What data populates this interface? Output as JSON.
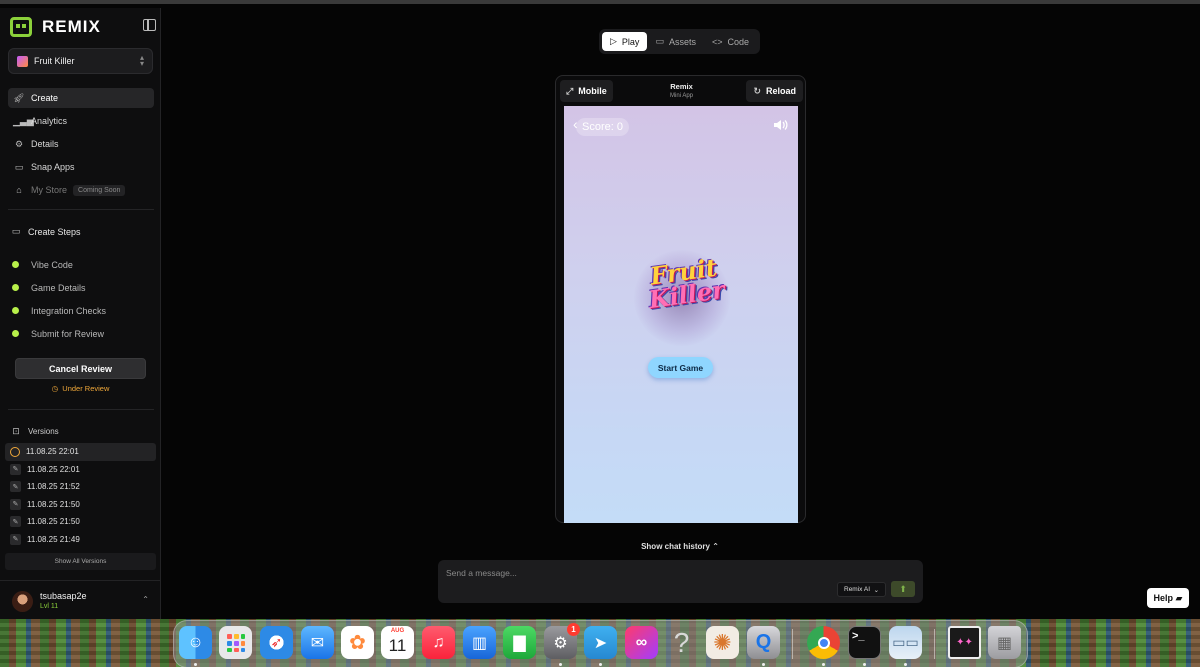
{
  "brand": {
    "name": "REMIX"
  },
  "project": {
    "name": "Fruit Killer"
  },
  "nav": [
    {
      "label": "Create",
      "icon": "rocket-icon"
    },
    {
      "label": "Analytics",
      "icon": "bar-chart-icon"
    },
    {
      "label": "Details",
      "icon": "gear-icon"
    },
    {
      "label": "Snap Apps",
      "icon": "monitor-icon"
    },
    {
      "label": "My Store",
      "icon": "store-icon",
      "badge": "Coming Soon"
    }
  ],
  "create_steps": {
    "title": "Create Steps",
    "items": [
      "Vibe Code",
      "Game Details",
      "Integration Checks",
      "Submit for Review"
    ],
    "dot_color": "#b8f04a"
  },
  "review": {
    "cancel_label": "Cancel Review",
    "status": "Under Review",
    "status_color": "#f0a83a"
  },
  "versions": {
    "title": "Versions",
    "items": [
      "11.08.25 22:01",
      "11.08.25 22:01",
      "11.08.25 21:52",
      "11.08.25 21:50",
      "11.08.25 21:50",
      "11.08.25 21:49"
    ],
    "show_all": "Show All Versions"
  },
  "user": {
    "name": "tsubasap2e",
    "level": "Lvl 11"
  },
  "tabs": [
    {
      "label": "Play",
      "icon": "play-icon"
    },
    {
      "label": "Assets",
      "icon": "folder-icon"
    },
    {
      "label": "Code",
      "icon": "code-icon"
    }
  ],
  "device": {
    "mobile_label": "Mobile",
    "title": "Remix",
    "subtitle": "Mini App",
    "reload_label": "Reload"
  },
  "game": {
    "score": "Score: 0",
    "logo_line1": "Fruit",
    "logo_line2": "Killer",
    "start_label": "Start Game"
  },
  "chat": {
    "history_label": "Show chat history",
    "placeholder": "Send a message...",
    "model": "Remix AI"
  },
  "help": {
    "label": "Help"
  },
  "dock": {
    "calendar_month": "AUG",
    "calendar_day": "11",
    "settings_badge": "1",
    "apps": [
      "finder",
      "launchpad",
      "safari",
      "mail",
      "photos",
      "calendar",
      "music",
      "keynote",
      "numbers",
      "system-settings",
      "telegram",
      "creative-cloud",
      "help",
      "claude",
      "quicktime",
      "chrome",
      "terminal",
      "preview",
      "downloads",
      "trash"
    ]
  },
  "accent": "#8cd13b"
}
